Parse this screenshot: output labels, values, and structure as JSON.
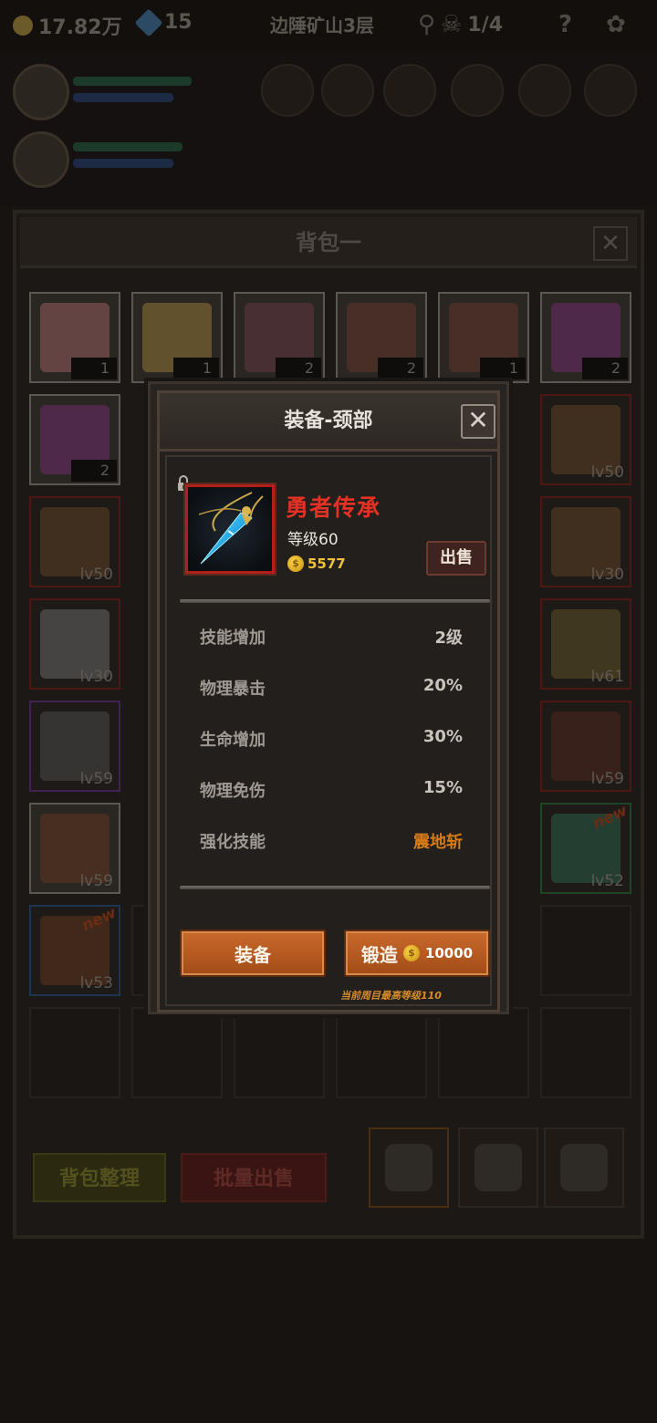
{
  "top_bar": {
    "gold": "17.82万",
    "gems": "15",
    "location": "边陲矿山3层",
    "kill_progress": "1/4",
    "icons": [
      "coin-icon",
      "gem-icon",
      "key-icon",
      "skull-icon",
      "help-icon",
      "gift-icon"
    ]
  },
  "backpack": {
    "title": "背包一",
    "organize_label": "背包整理",
    "bulk_sell_label": "批量出售",
    "slots": [
      {
        "qty": "1",
        "border": "white",
        "art": "#a86b6b"
      },
      {
        "qty": "1",
        "border": "white",
        "art": "#a58a3b"
      },
      {
        "qty": "2",
        "border": "white",
        "art": "#6a3b4a"
      },
      {
        "qty": "2",
        "border": "white",
        "art": "#6a3b2f"
      },
      {
        "qty": "1",
        "border": "white",
        "art": "#6a3b2f"
      },
      {
        "qty": "2",
        "border": "white",
        "art": "#7a2f7a"
      },
      {
        "qty": "2",
        "border": "white",
        "art": "#7a2f7a"
      },
      {
        "lvl": "lv50",
        "border": "red",
        "art": "#6b4a2a"
      },
      {
        "lvl": "lv50",
        "border": "red",
        "art": "#6b4a2a"
      },
      {
        "lvl": "lv30",
        "border": "red",
        "art": "#6b4a2a"
      },
      {
        "lvl": "lv30",
        "border": "red",
        "art": "#777"
      },
      {
        "lvl": "lv61",
        "border": "red",
        "art": "#6b5a2a"
      },
      {
        "lvl": "lv59",
        "border": "purple",
        "art": "#555"
      },
      {
        "lvl": "lv59",
        "border": "red",
        "art": "#5a2a22"
      },
      {
        "lvl": "lv59",
        "border": "white",
        "art": "#6b3a22"
      },
      {
        "lvl": "lv52",
        "border": "green",
        "art": "#2f6b55",
        "new": "new"
      },
      {
        "lvl": "lv53",
        "border": "blue",
        "art": "#6b3a22",
        "new": "new"
      }
    ]
  },
  "modal": {
    "title": "装备-颈部",
    "close_icon": "close-icon",
    "item": {
      "name": "勇者传承",
      "level": "等级60",
      "price": "5577",
      "icon": "pendant-icon",
      "lock_icon": "lock-icon"
    },
    "sell_label": "出售",
    "attributes": [
      {
        "name": "技能增加",
        "value": "2级"
      },
      {
        "name": "物理暴击",
        "value": "20%"
      },
      {
        "name": "生命增加",
        "value": "30%"
      },
      {
        "name": "物理免伤",
        "value": "15%"
      },
      {
        "name": "强化技能",
        "value": "震地斩"
      }
    ],
    "equip_label": "装备",
    "forge_label": "锻造",
    "forge_cost": "10000",
    "max_level_note": "当前周目最高等级110",
    "colors": {
      "item_name": "#e33124",
      "gold_text": "#f0c23a",
      "skill_orange": "#d77a17",
      "button_orange": "#c0622a"
    }
  }
}
